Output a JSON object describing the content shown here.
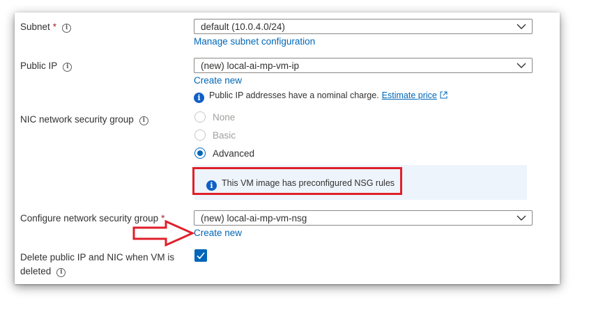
{
  "subnet": {
    "label": "Subnet",
    "required_mark": "*",
    "value": "default (10.0.4.0/24)",
    "link": "Manage subnet configuration"
  },
  "public_ip": {
    "label": "Public IP",
    "value": "(new) local-ai-mp-vm-ip",
    "link": "Create new",
    "note": "Public IP addresses have a nominal charge.",
    "note_link": "Estimate price"
  },
  "nic_nsg": {
    "label": "NIC network security group",
    "options": [
      "None",
      "Basic",
      "Advanced"
    ],
    "selected": "Advanced",
    "info_message": "This VM image has preconfigured NSG rules"
  },
  "configure_nsg": {
    "label": "Configure network security group",
    "required_mark": "*",
    "value": "(new) local-ai-mp-vm-nsg",
    "link": "Create new"
  },
  "delete_option": {
    "label_line1": "Delete public IP and NIC when VM is",
    "label_line2": "deleted",
    "checked": true
  },
  "colors": {
    "accent": "#0067b8",
    "required": "#a4262c",
    "highlight": "#e0202a",
    "info_bg": "#eef4fb"
  },
  "icons": [
    "info-icon",
    "chevron-down-icon",
    "external-link-icon",
    "checkmark-icon",
    "arrow-annotation"
  ]
}
